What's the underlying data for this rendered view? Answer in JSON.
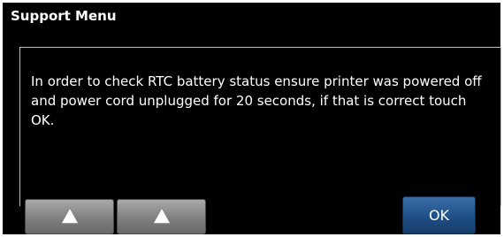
{
  "window": {
    "title": "Support Menu"
  },
  "dialog": {
    "message": "In order to check RTC battery status ensure printer was powered off and power cord unplugged for 20 seconds, if that is correct touch OK."
  },
  "buttons": {
    "up_left_icon": "up-arrow-icon",
    "up_right_icon": "up-arrow-icon",
    "ok_label": "OK"
  },
  "colors": {
    "background": "#000000",
    "ok_button": "#1f4f86",
    "nav_button": "#7f7f7f"
  }
}
